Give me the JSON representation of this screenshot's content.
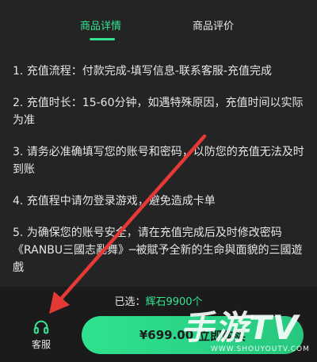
{
  "tabs": [
    {
      "label": "商品详情",
      "active": true
    },
    {
      "label": "商品评价",
      "active": false
    }
  ],
  "details": [
    "1. 充值流程：付款完成-填写信息-联系客服-充值完成",
    "2. 充值时长：15-60分钟，如遇特殊原因，充值时间以实际为准",
    "3. 请务必准确填写您的账号和密码，以防您的充值无法及时到账",
    "4. 充值程中请勿登录游戏，避免造成卡单",
    "5. 为确保您的账号安全，请在充值完成后及时修改密码《RANBU三國志亂舞》─被賦予全新的生命與面貌的三國遊戲"
  ],
  "selection": {
    "prefix": "已选：",
    "value": "辉石9900个"
  },
  "service": {
    "label": "客服",
    "icon": "headset-icon"
  },
  "buy": {
    "price": "¥699.00",
    "label": "立即购买"
  },
  "watermark": {
    "title": "手游TV",
    "url": "WWW.SHOUYOUTV.COM"
  },
  "colors": {
    "accent": "#33e592",
    "background": "#242424",
    "arrow": "#e53935"
  }
}
